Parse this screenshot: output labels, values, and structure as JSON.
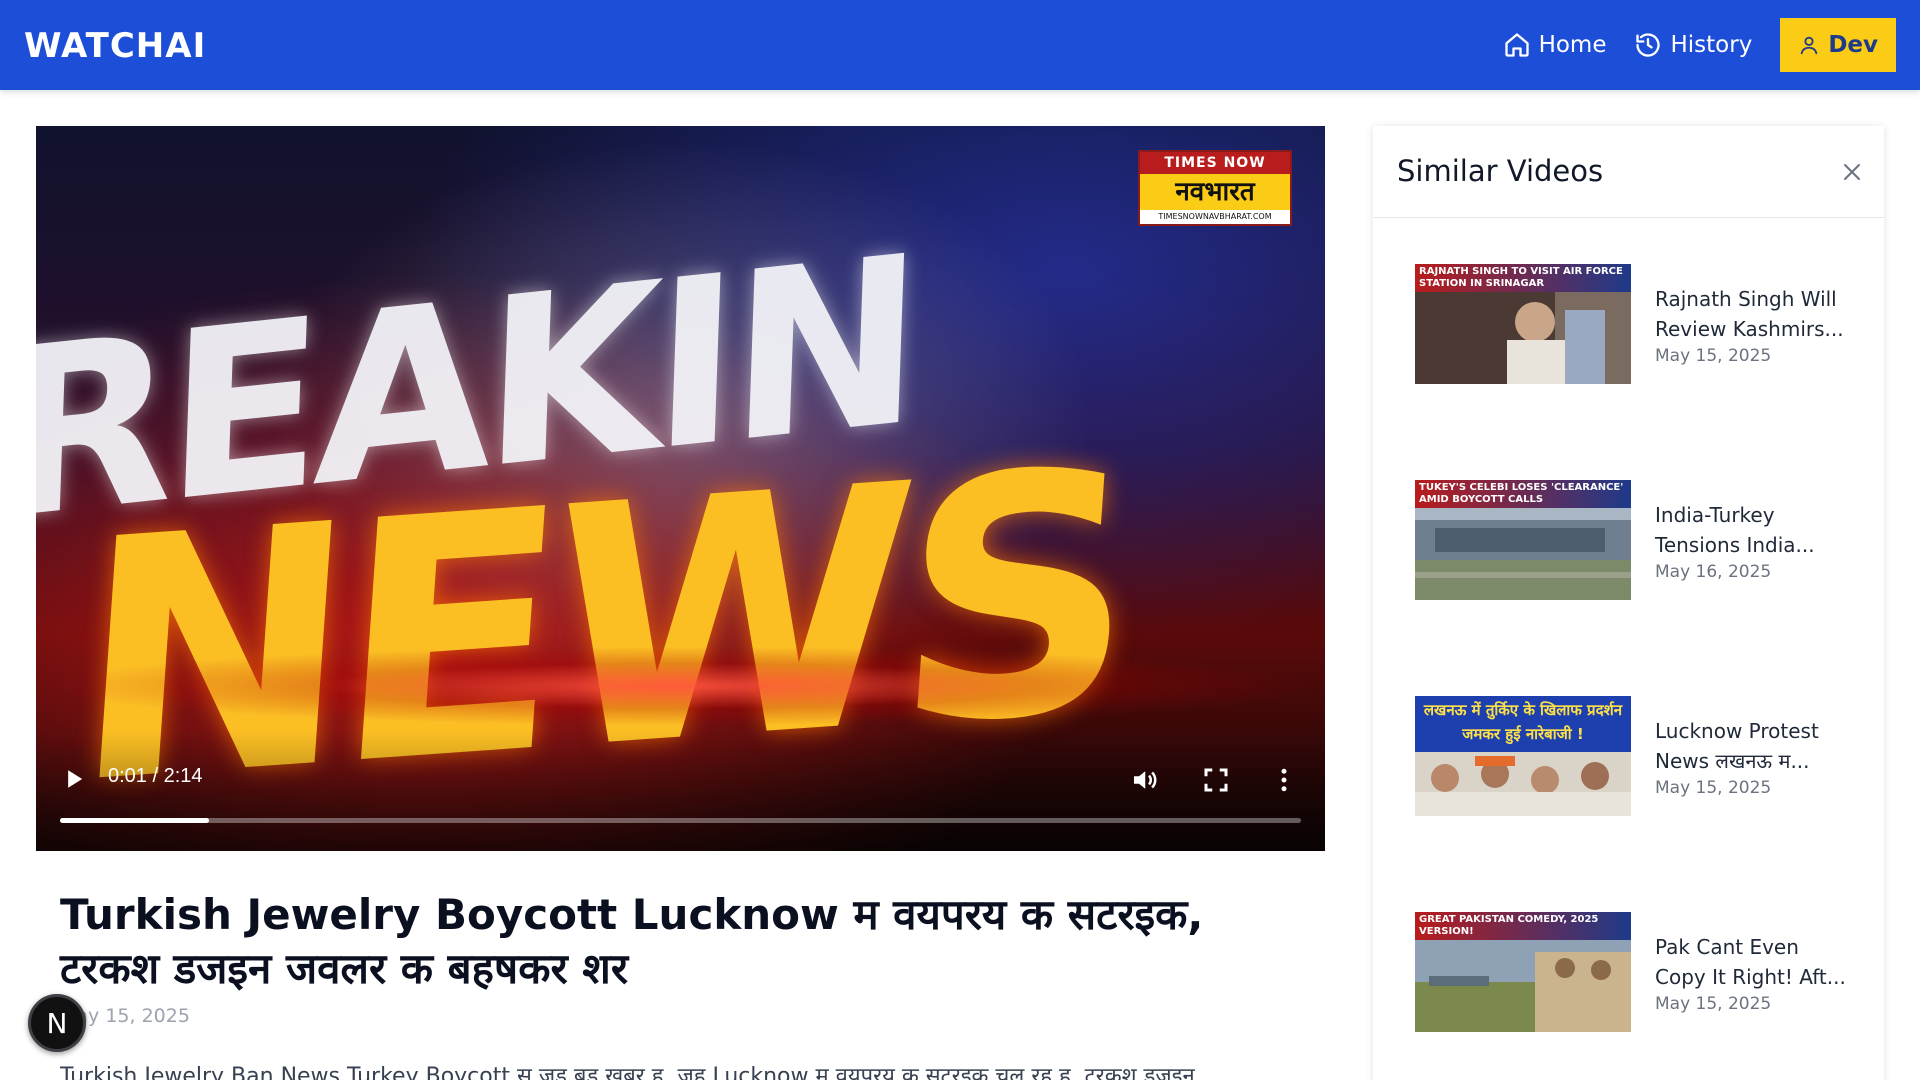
{
  "app": {
    "logo": "WATCHAI"
  },
  "nav": {
    "home": "Home",
    "history": "History",
    "user": "Dev"
  },
  "video": {
    "time": "0:01 / 2:14",
    "progress_fraction": 0.12,
    "overlay_line1": "REAKIN",
    "overlay_line2": "NEWS",
    "channel_logo": {
      "top": "TIMES NOW",
      "mid": "नवभारत",
      "bottom": "TIMESNOWNAVBHARAT.COM"
    },
    "title": "Turkish Jewelry Boycott Lucknow म वयपरय क सटरइक, टरकश डजइन जवलर क बहषकर शर",
    "date": "May 15, 2025",
    "description": "Turkish Jewelry Ban News Turkey Boycott स जड बड खबर ह. जह Lucknow म वयपरय क सटरइक चल रह ह. टरकश डजइन"
  },
  "floating_badge": "N",
  "sidebar": {
    "title": "Similar Videos",
    "items": [
      {
        "thumb_text": "RAJNATH SINGH TO VISIT AIR FORCE STATION IN SRINAGAR",
        "title": "Rajnath Singh Will Review Kashmirs...",
        "date": "May 15, 2025"
      },
      {
        "thumb_text": "TUKEY'S CELEBI LOSES 'CLEARANCE' AMID BOYCOTT CALLS",
        "title": "India-Turkey Tensions India...",
        "date": "May 16, 2025"
      },
      {
        "thumb_text": "लखनऊ में तुर्किए के खिलाफ प्रदर्शन जमकर हुई नारेबाजी !",
        "title": "Lucknow Protest News लखनऊ म...",
        "date": "May 15, 2025"
      },
      {
        "thumb_text": "GREAT PAKISTAN COMEDY, 2025 VERSION!",
        "title": "Pak Cant Even Copy It Right! Aft...",
        "date": "May 15, 2025"
      }
    ]
  }
}
